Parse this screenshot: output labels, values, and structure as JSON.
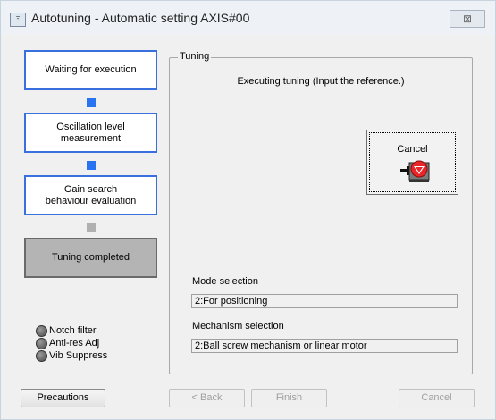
{
  "window": {
    "icon_text": "Ξ",
    "title": "Autotuning - Automatic setting AXIS#00",
    "close_glyph": "⊠"
  },
  "steps": [
    {
      "label": "Waiting for execution",
      "state": "active"
    },
    {
      "label": "Oscillation level\nmeasurement",
      "state": "active"
    },
    {
      "label": "Gain search\nbehaviour evaluation",
      "state": "active"
    },
    {
      "label": "Tuning completed",
      "state": "done"
    }
  ],
  "indicators": [
    {
      "label": "Notch filter"
    },
    {
      "label": "Anti-res Adj"
    },
    {
      "label": "Vib Suppress"
    }
  ],
  "tuning": {
    "group_title": "Tuning",
    "status_message": "Executing tuning (Input the reference.)",
    "cancel_label": "Cancel",
    "mode_label": "Mode selection",
    "mode_value": "2:For positioning",
    "mechanism_label": "Mechanism selection",
    "mechanism_value": "2:Ball screw mechanism or linear motor"
  },
  "buttons": {
    "precautions": "Precautions",
    "back": "< Back",
    "finish": "Finish",
    "cancel": "Cancel"
  },
  "colors": {
    "step_border": "#3a6fe0",
    "connector_active": "#2a73f0",
    "connector_inactive": "#b0b0b0",
    "stop_icon_red": "#e8262a"
  }
}
